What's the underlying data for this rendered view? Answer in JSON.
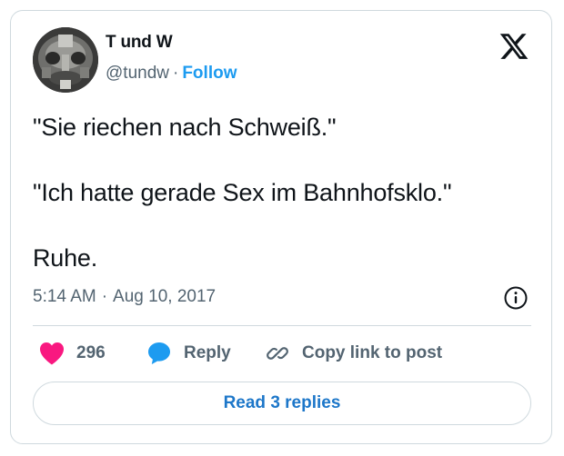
{
  "author": {
    "display_name": "T und W",
    "handle": "@tundw",
    "separator": "·",
    "follow_label": "Follow"
  },
  "tweet": {
    "paragraphs": [
      "\"Sie riechen nach Schweiß.\"",
      "\"Ich hatte gerade Sex im Bahnhofsklo.\"",
      "Ruhe."
    ]
  },
  "meta": {
    "time": "5:14 AM",
    "separator": "·",
    "date": "Aug 10, 2017"
  },
  "actions": {
    "like_count": "296",
    "reply_label": "Reply",
    "copy_label": "Copy link to post"
  },
  "footer": {
    "read_replies_label": "Read 3 replies"
  },
  "icons": {
    "brand": "x-logo-icon",
    "info": "info-icon",
    "like": "heart-icon",
    "reply": "speech-bubble-icon",
    "copy": "link-icon"
  },
  "colors": {
    "heart": "#f91880",
    "reply_bubble": "#1d9bf0",
    "follow": "#1d9bf0",
    "read_replies": "#1d77c9",
    "muted_text": "#536471",
    "border": "#cfd9de"
  }
}
